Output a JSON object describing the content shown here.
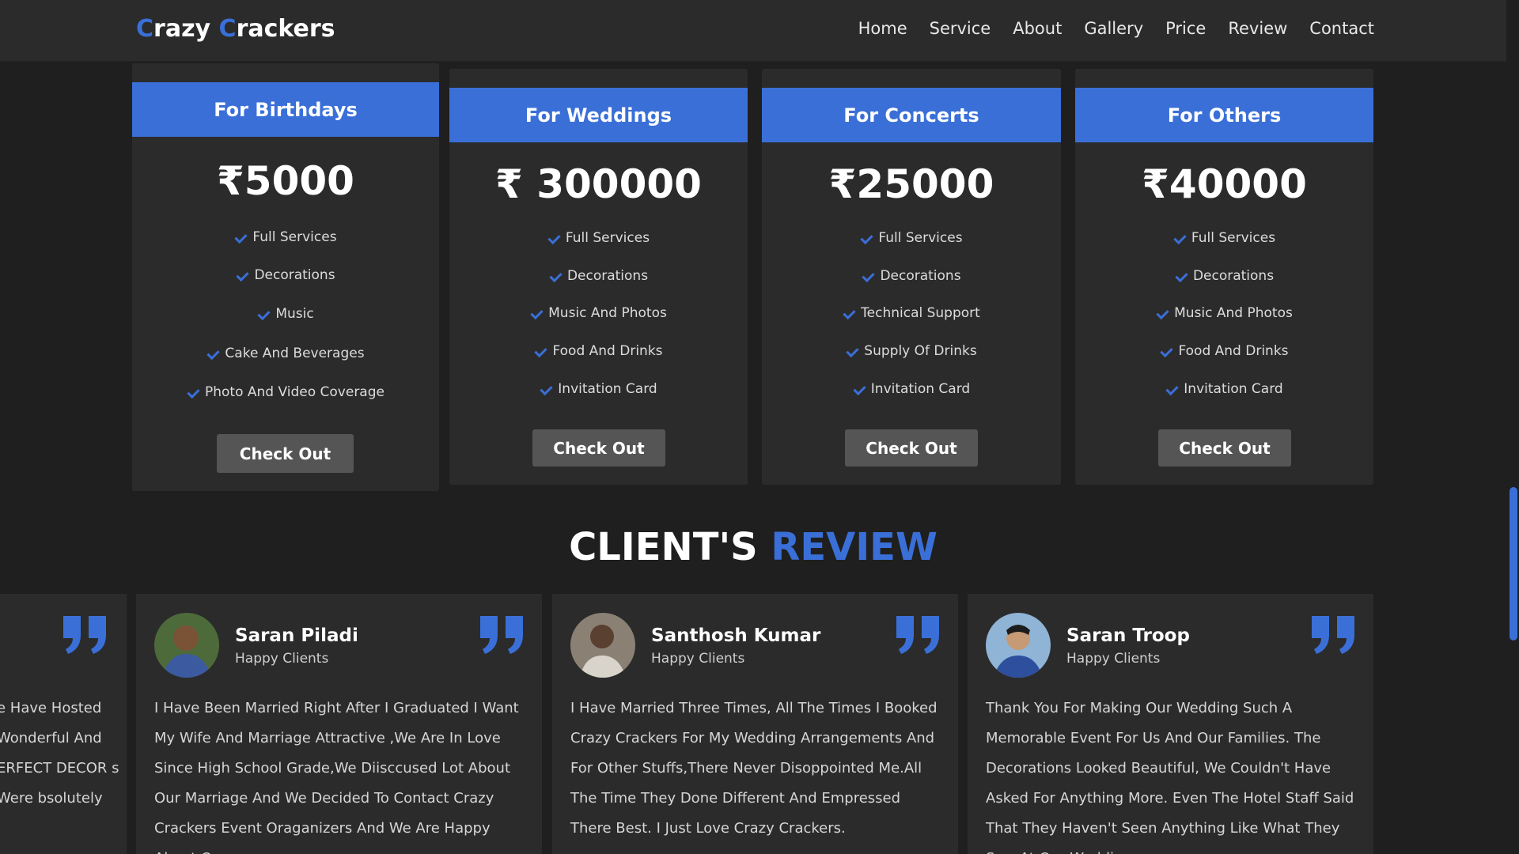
{
  "brand": {
    "first_letter": "C",
    "first_rest": "razy ",
    "second_letter": "C",
    "second_rest": "rackers",
    "accent_color": "#3a6fd8"
  },
  "nav": [
    "Home",
    "Service",
    "About",
    "Gallery",
    "Price",
    "Review",
    "Contact"
  ],
  "plans": [
    {
      "title": "For Birthdays",
      "price": "₹5000",
      "features": [
        "Full Services",
        "Decorations",
        "Music",
        "Cake And Beverages",
        "Photo And Video Coverage"
      ],
      "button": "Check Out"
    },
    {
      "title": "For Weddings",
      "price": "₹ 300000",
      "features": [
        "Full Services",
        "Decorations",
        "Music And Photos",
        "Food And Drinks",
        "Invitation Card"
      ],
      "button": "Check Out"
    },
    {
      "title": "For Concerts",
      "price": "₹25000",
      "features": [
        "Full Services",
        "Decorations",
        "Technical Support",
        "Supply Of Drinks",
        "Invitation Card"
      ],
      "button": "Check Out"
    },
    {
      "title": "For Others",
      "price": "₹40000",
      "features": [
        "Full Services",
        "Decorations",
        "Music And Photos",
        "Food And Drinks",
        "Invitation Card"
      ],
      "button": "Check Out"
    }
  ],
  "reviews_title": {
    "white": "CLIENT'S ",
    "blue": "REVIEW"
  },
  "partial_review": {
    "text": "e Have Hosted Wonderful And ERFECT DECOR s Were bsolutely"
  },
  "reviews": [
    {
      "name": "Saran Piladi",
      "role": "Happy Clients",
      "text": "I Have Been Married Right After I Graduated I Want My Wife And Marriage Attractive ,We Are In Love Since High School Grade,We Diisccused Lot About Our Marriage And We Decided To Contact Crazy Crackers Event Oraganizers And We Are Happy About Our"
    },
    {
      "name": "Santhosh Kumar",
      "role": "Happy Clients",
      "text": "I Have Married Three Times, All The Times I Booked Crazy Crackers For My Wedding Arrangements And For Other Stuffs,There Never Disoppointed Me.All The Time They Done Different And Empressed There Best. I Just Love Crazy Crackers."
    },
    {
      "name": "Saran Troop",
      "role": "Happy Clients",
      "text": "Thank You For Making Our Wedding Such A Memorable Event For Us And Our Families. The Decorations Looked Beautiful, We Couldn't Have Asked For Anything More. Even The Hotel Staff Said That They Haven't Seen Anything Like What They Saw At Our Wedding."
    }
  ]
}
